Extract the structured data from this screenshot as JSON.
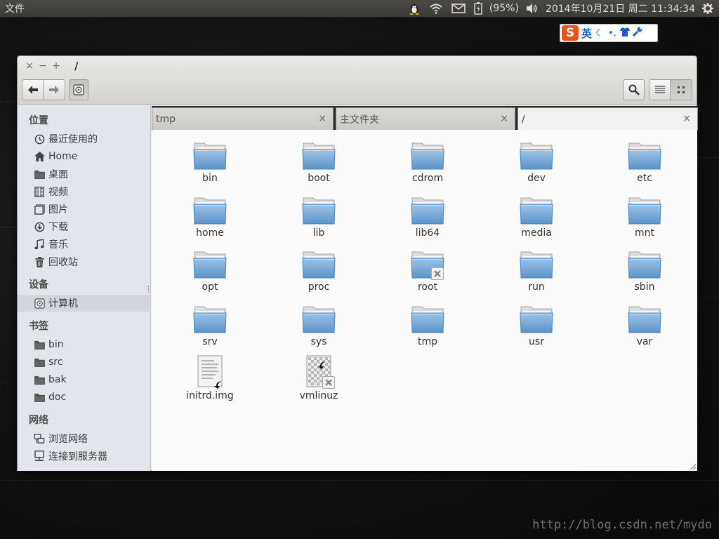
{
  "top_panel": {
    "app_menu": "文件",
    "battery_text": "(95%)",
    "datetime": "2014年10月21日 周二 11:34:34"
  },
  "ime": {
    "logo": "S",
    "language": "英"
  },
  "window": {
    "title": "/",
    "controls": {
      "close": "×",
      "minimize": "−",
      "maximize": "+"
    }
  },
  "sidebar": {
    "sections": [
      {
        "title": "位置",
        "items": [
          {
            "label": "最近使用的",
            "icon": "clock-icon"
          },
          {
            "label": "Home",
            "icon": "home-icon"
          },
          {
            "label": "桌面",
            "icon": "folder-icon"
          },
          {
            "label": "视频",
            "icon": "film-icon"
          },
          {
            "label": "图片",
            "icon": "picture-icon"
          },
          {
            "label": "下载",
            "icon": "download-icon"
          },
          {
            "label": "音乐",
            "icon": "music-icon"
          },
          {
            "label": "回收站",
            "icon": "trash-icon"
          }
        ]
      },
      {
        "title": "设备",
        "items": [
          {
            "label": "计算机",
            "icon": "disk-icon",
            "selected": true
          }
        ]
      },
      {
        "title": "书签",
        "items": [
          {
            "label": "bin",
            "icon": "folder-icon"
          },
          {
            "label": "src",
            "icon": "folder-icon"
          },
          {
            "label": "bak",
            "icon": "folder-icon"
          },
          {
            "label": "doc",
            "icon": "folder-icon"
          }
        ]
      },
      {
        "title": "网络",
        "items": [
          {
            "label": "浏览网络",
            "icon": "network-icon"
          },
          {
            "label": "连接到服务器",
            "icon": "server-icon"
          }
        ]
      }
    ]
  },
  "tabs": [
    {
      "label": "tmp",
      "active": false
    },
    {
      "label": "主文件夹",
      "active": false
    },
    {
      "label": "/",
      "active": true
    }
  ],
  "files": [
    {
      "name": "bin",
      "type": "folder"
    },
    {
      "name": "boot",
      "type": "folder"
    },
    {
      "name": "cdrom",
      "type": "folder"
    },
    {
      "name": "dev",
      "type": "folder"
    },
    {
      "name": "etc",
      "type": "folder"
    },
    {
      "name": "home",
      "type": "folder"
    },
    {
      "name": "lib",
      "type": "folder"
    },
    {
      "name": "lib64",
      "type": "folder"
    },
    {
      "name": "media",
      "type": "folder"
    },
    {
      "name": "mnt",
      "type": "folder"
    },
    {
      "name": "opt",
      "type": "folder"
    },
    {
      "name": "proc",
      "type": "folder"
    },
    {
      "name": "root",
      "type": "folder-locked"
    },
    {
      "name": "run",
      "type": "folder"
    },
    {
      "name": "sbin",
      "type": "folder"
    },
    {
      "name": "srv",
      "type": "folder"
    },
    {
      "name": "sys",
      "type": "folder"
    },
    {
      "name": "tmp",
      "type": "folder"
    },
    {
      "name": "usr",
      "type": "folder"
    },
    {
      "name": "var",
      "type": "folder"
    },
    {
      "name": "initrd.img",
      "type": "text-link"
    },
    {
      "name": "vmlinuz",
      "type": "binary-link-locked"
    }
  ],
  "watermark": "http://blog.csdn.net/mydo",
  "colors": {
    "panel_bg": "#3b3a36",
    "folder_blue": "#6fa6d6",
    "sidebar_bg": "#e2e6ec"
  }
}
